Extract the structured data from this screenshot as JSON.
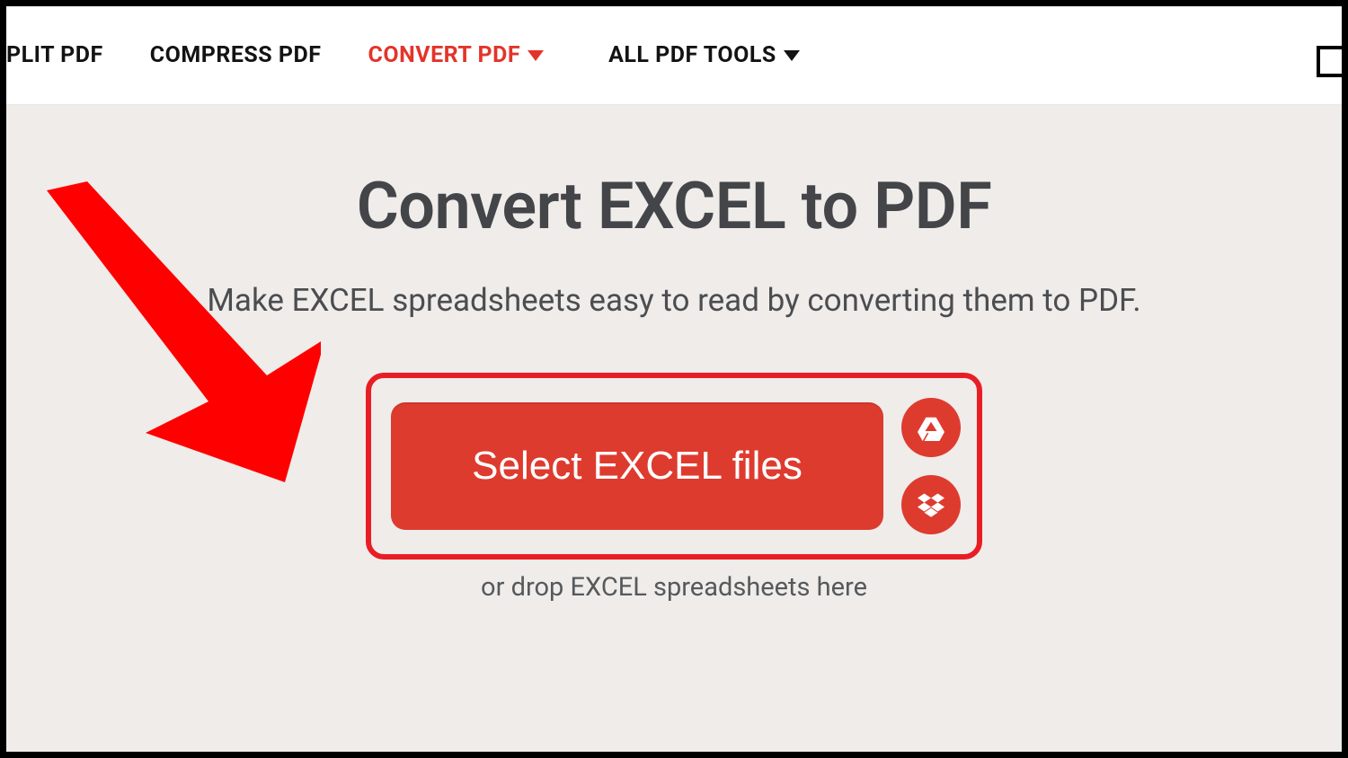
{
  "nav": {
    "items": [
      {
        "label": "PLIT PDF",
        "active": false,
        "has_caret": false
      },
      {
        "label": "COMPRESS PDF",
        "active": false,
        "has_caret": false
      },
      {
        "label": "CONVERT PDF",
        "active": true,
        "has_caret": true
      },
      {
        "label": "ALL PDF TOOLS",
        "active": false,
        "has_caret": true
      }
    ]
  },
  "page": {
    "title": "Convert EXCEL to PDF",
    "subtitle": "Make EXCEL spreadsheets easy to read by converting them to PDF.",
    "select_button": "Select EXCEL files",
    "drop_hint": "or drop EXCEL spreadsheets here"
  },
  "icons": {
    "drive": "google-drive-icon",
    "dropbox": "dropbox-icon"
  },
  "annotation": {
    "arrow_color": "#ff0000",
    "highlight_color": "#e91e25"
  }
}
